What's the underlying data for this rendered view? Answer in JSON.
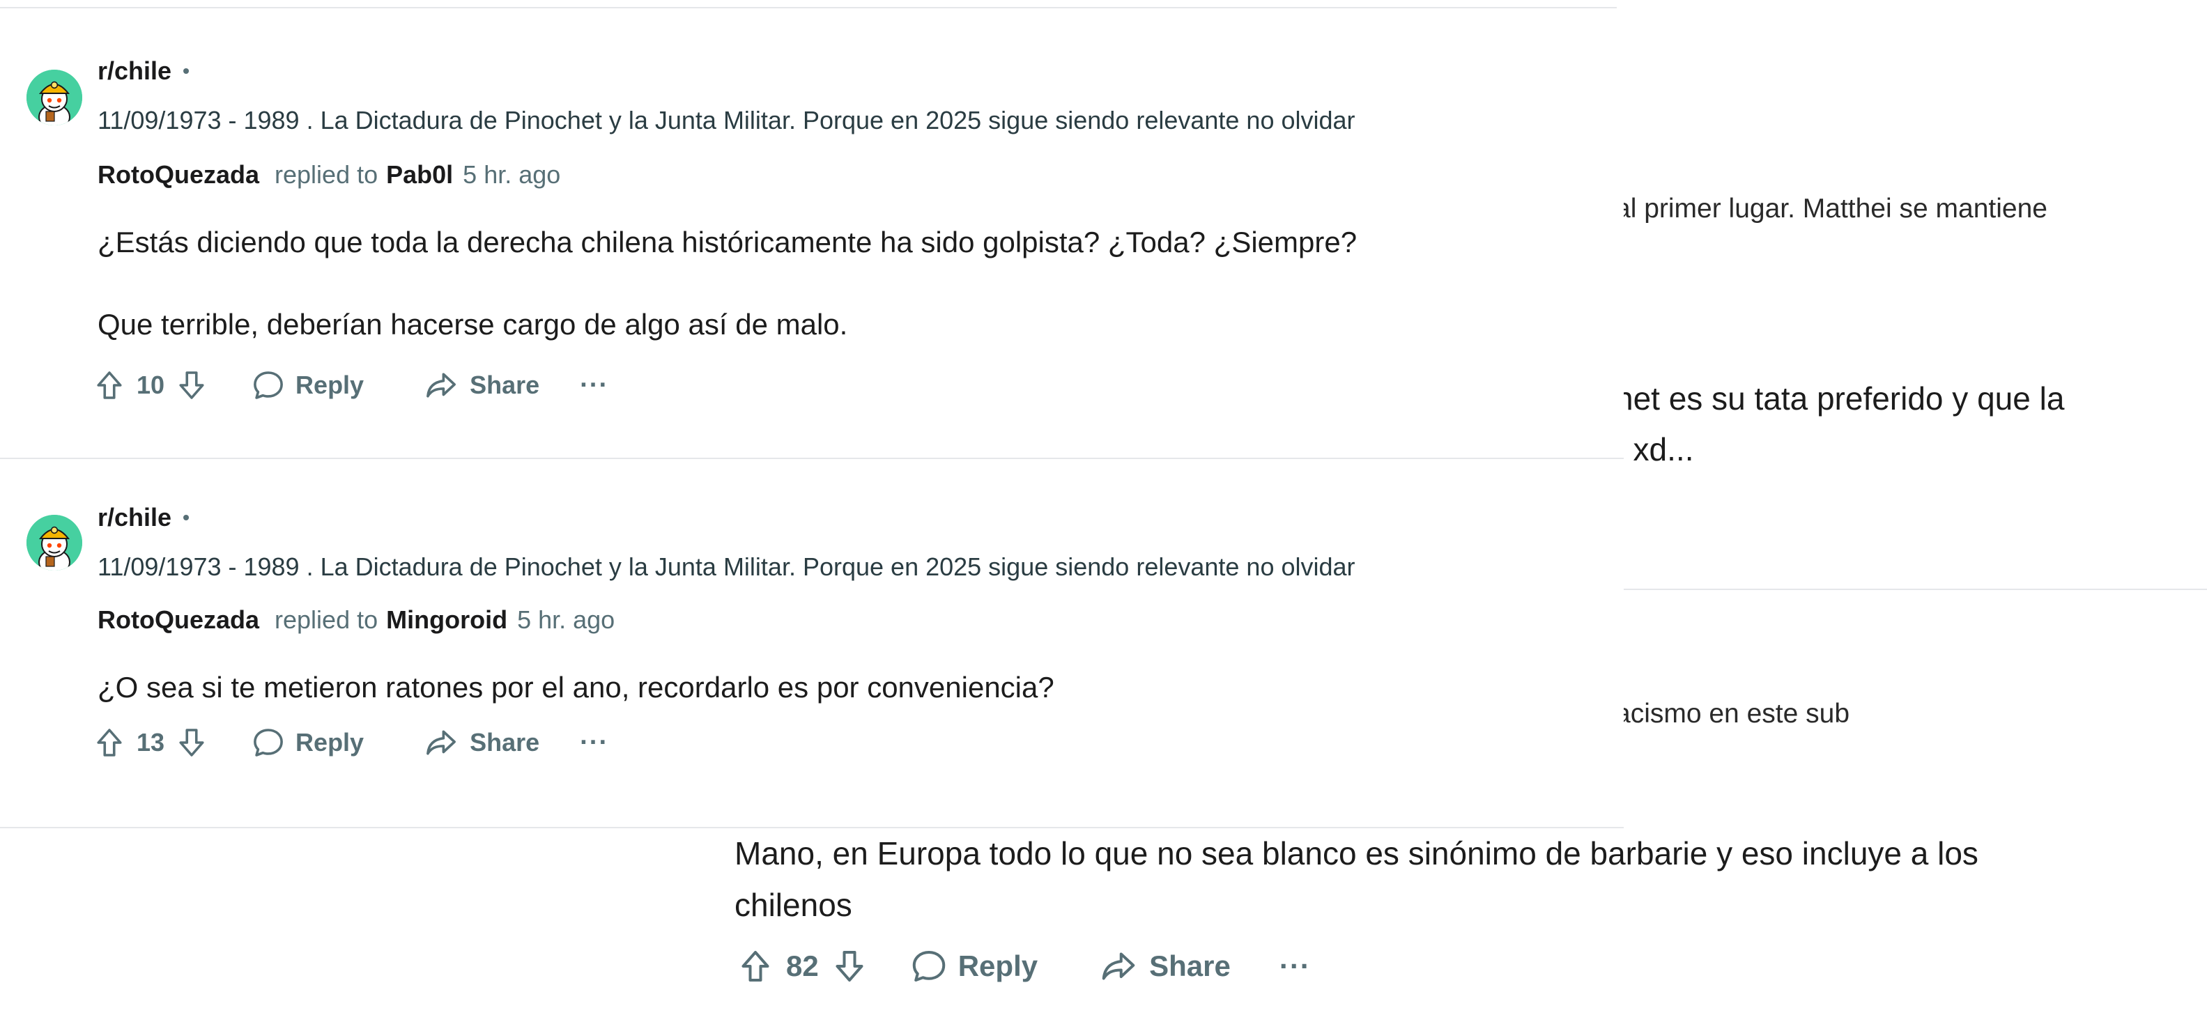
{
  "background": {
    "fragments": [
      "al primer lugar. Matthei se mantiene",
      "het es su tata preferido y que la",
      ", xd...",
      "acismo en este sub"
    ],
    "comment": {
      "body": "Mano, en Europa todo lo que no sea blanco es sinónimo de barbarie y eso incluye a los chilenos",
      "votes": "82",
      "reply_label": "Reply",
      "share_label": "Share",
      "more_label": "···"
    }
  },
  "results": [
    {
      "subreddit": "r/chile",
      "dot": "•",
      "post_title": "11/09/1973 - 1989 . La Dictadura de Pinochet y la Junta Militar. Porque en 2025 sigue siendo relevante no olvidar",
      "author": "RotoQuezada",
      "replied_label": "replied to",
      "replied_to": "Pab0l",
      "time": "5 hr. ago",
      "paragraphs": [
        "¿Estás diciendo que toda la derecha chilena históricamente ha sido golpista? ¿Toda? ¿Siempre?",
        "Que terrible, deberían hacerse cargo de algo así de malo."
      ],
      "votes": "10",
      "reply_label": "Reply",
      "share_label": "Share",
      "more_label": "···"
    },
    {
      "subreddit": "r/chile",
      "dot": "•",
      "post_title": "11/09/1973 - 1989 . La Dictadura de Pinochet y la Junta Militar. Porque en 2025 sigue siendo relevante no olvidar",
      "author": "RotoQuezada",
      "replied_label": "replied to",
      "replied_to": "Mingoroid",
      "time": "5 hr. ago",
      "paragraphs": [
        "¿O sea si te metieron ratones por el ano, recordarlo es por conveniencia?"
      ],
      "votes": "13",
      "reply_label": "Reply",
      "share_label": "Share",
      "more_label": "···"
    }
  ],
  "colors": {
    "meta_gray": "#576f76",
    "divider": "#e5e7ea",
    "avatar_bg": "#46d0a0",
    "snoo_helmet": "#f5b400"
  },
  "icons": [
    "upvote-icon",
    "downvote-icon",
    "comment-bubble-icon",
    "share-arrow-icon",
    "more-options-icon",
    "subreddit-avatar-icon"
  ]
}
